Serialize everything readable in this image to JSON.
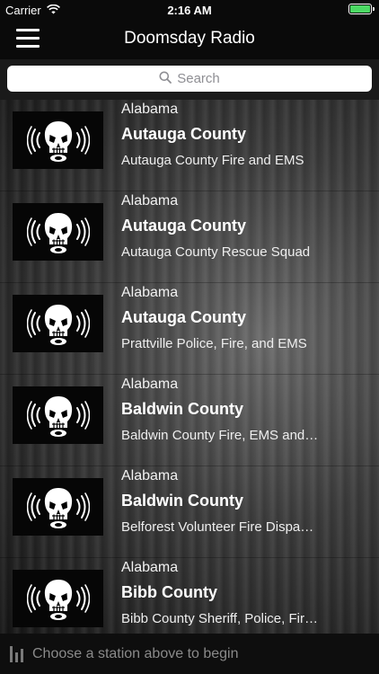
{
  "status": {
    "carrier": "Carrier",
    "time": "2:16 AM",
    "battery_color": "#4cd964"
  },
  "nav": {
    "title": "Doomsday Radio",
    "menu_icon": "hamburger-menu-icon"
  },
  "search": {
    "placeholder": "Search",
    "icon": "search-icon"
  },
  "stations": [
    {
      "state": "Alabama",
      "county": "Autauga County",
      "name": "Autauga County Fire and EMS"
    },
    {
      "state": "Alabama",
      "county": "Autauga County",
      "name": "Autauga County Rescue Squad"
    },
    {
      "state": "Alabama",
      "county": "Autauga County",
      "name": "Prattville Police, Fire, and EMS"
    },
    {
      "state": "Alabama",
      "county": "Baldwin County",
      "name": "Baldwin County Fire, EMS and…"
    },
    {
      "state": "Alabama",
      "county": "Baldwin County",
      "name": "Belforest Volunteer Fire Dispa…"
    },
    {
      "state": "Alabama",
      "county": "Bibb County",
      "name": "Bibb County Sheriff, Police, Fir…"
    }
  ],
  "player": {
    "prompt": "Choose a station above to begin",
    "icon": "equalizer-icon"
  }
}
